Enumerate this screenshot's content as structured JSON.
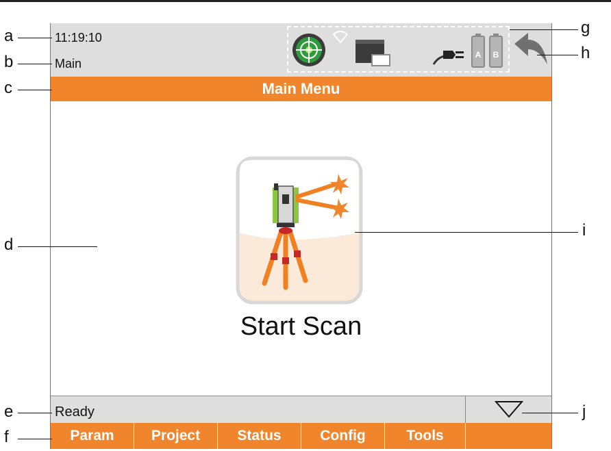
{
  "header": {
    "time": "11:19:10",
    "context": "Main"
  },
  "titlebar": {
    "title": "Main Menu"
  },
  "main": {
    "tile": {
      "label": "Start Scan",
      "icon": "scanner-on-tripod-icon"
    }
  },
  "statusbar": {
    "text": "Ready"
  },
  "function_keys": [
    {
      "label": "Param"
    },
    {
      "label": "Project"
    },
    {
      "label": "Status"
    },
    {
      "label": "Config"
    },
    {
      "label": "Tools"
    },
    {
      "label": ""
    }
  ],
  "callouts": {
    "a": "a",
    "b": "b",
    "c": "c",
    "d": "d",
    "e": "e",
    "f": "f",
    "g": "g",
    "h": "h",
    "i": "i",
    "j": "j"
  },
  "colors": {
    "accent_orange": "#f0852b",
    "header_gray": "#dedede",
    "level_green": "#2e9b3c"
  }
}
